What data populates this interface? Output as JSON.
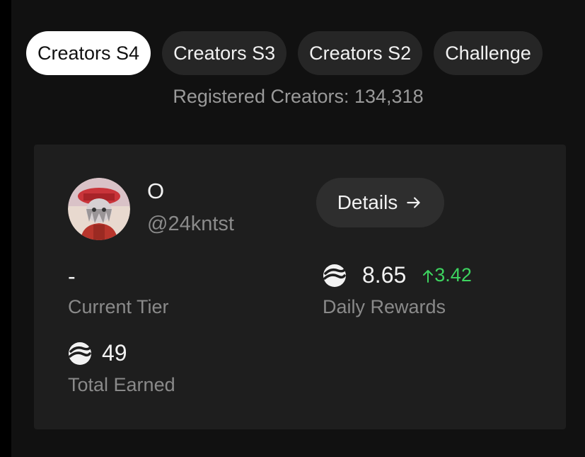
{
  "tabs": [
    {
      "label": "Creators S4",
      "active": true
    },
    {
      "label": "Creators S3",
      "active": false
    },
    {
      "label": "Creators S2",
      "active": false
    },
    {
      "label": "Challenge",
      "active": false
    }
  ],
  "registered_text": "Registered Creators: 134,318",
  "profile": {
    "name": "O",
    "handle": "@24kntst",
    "details_label": "Details"
  },
  "stats": {
    "current_tier": {
      "value": "-",
      "label": "Current Tier"
    },
    "daily_rewards": {
      "value": "8.65",
      "delta": "3.42",
      "label": "Daily Rewards"
    },
    "total_earned": {
      "value": "49",
      "label": "Total Earned"
    }
  },
  "icons": {
    "token": "token-icon",
    "details_arrow": "arrow-right-icon",
    "delta_arrow": "arrow-up-icon"
  },
  "colors": {
    "background": "#000000",
    "panel": "#111111",
    "card": "#1e1e1e",
    "tab_inactive": "#262626",
    "tab_active": "#ffffff",
    "positive": "#3dd35f",
    "muted_text": "#8a8a8a"
  }
}
